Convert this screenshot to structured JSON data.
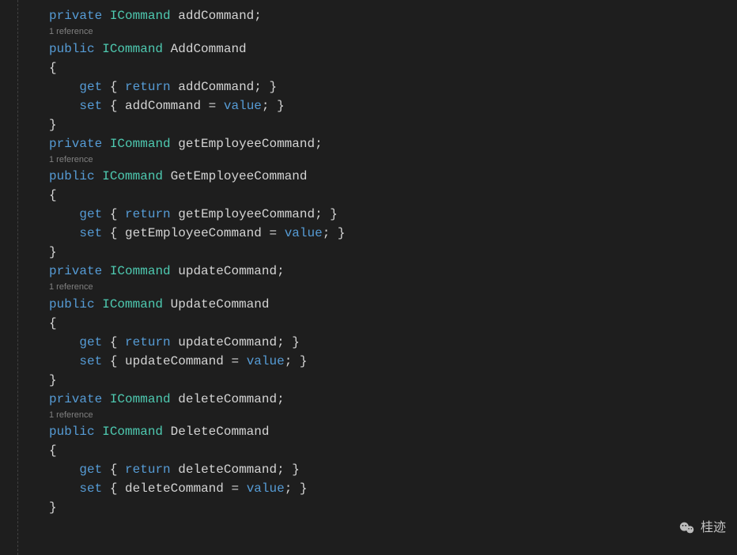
{
  "refText": "1 reference",
  "blocks": [
    {
      "access": "private",
      "type": "ICommand",
      "field": "addCommand",
      "prop": "AddCommand"
    },
    {
      "access": "private",
      "type": "ICommand",
      "field": "getEmployeeCommand",
      "prop": "GetEmployeeCommand"
    },
    {
      "access": "private",
      "type": "ICommand",
      "field": "updateCommand",
      "prop": "UpdateCommand"
    },
    {
      "access": "private",
      "type": "ICommand",
      "field": "deleteCommand",
      "prop": "DeleteCommand"
    }
  ],
  "keywords": {
    "public": "public",
    "get": "get",
    "set": "set",
    "return": "return",
    "value": "value"
  },
  "watermark": "桂迹"
}
